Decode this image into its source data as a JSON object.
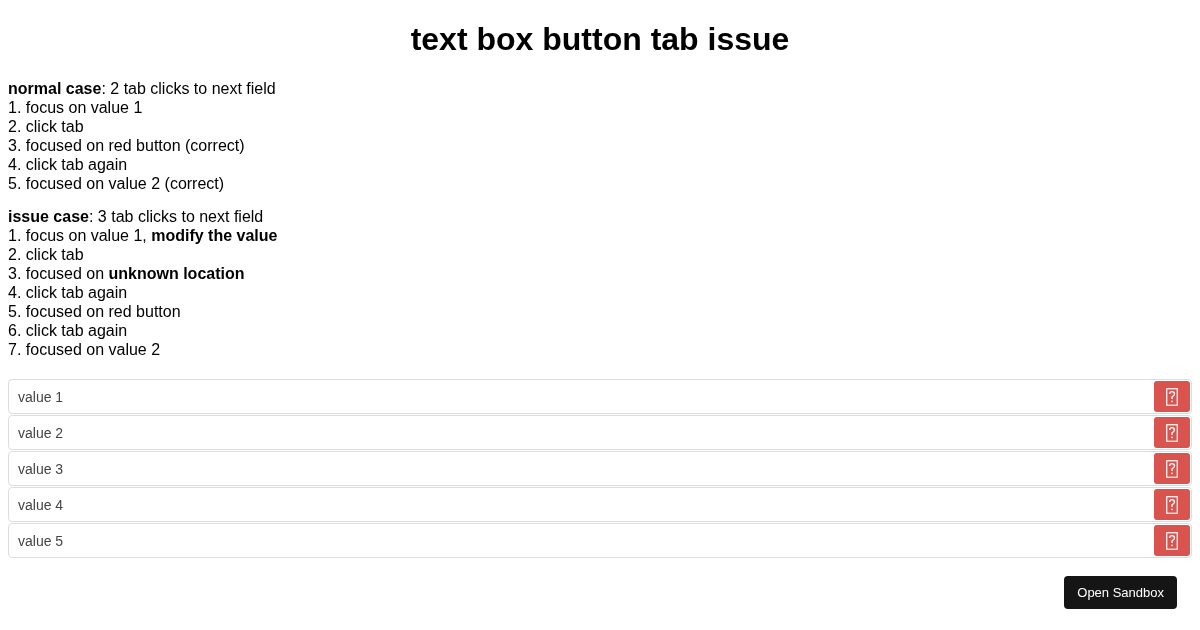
{
  "title": "text box button tab issue",
  "sections": [
    {
      "lines": [
        "**normal case**: 2 tab clicks to next field",
        "1. focus on value 1",
        "2. click tab",
        "3. focused on red button (correct)",
        "4. click tab again",
        "5. focused on value 2 (correct)"
      ]
    },
    {
      "lines": [
        "**issue case**: 3 tab clicks to next field",
        "1. focus on value 1, **modify the value**",
        "2. click tab",
        "3. focused on **unknown location**",
        "4. click tab again",
        "5. focused on red button",
        "6. click tab again",
        "7. focused on value 2"
      ]
    }
  ],
  "fields": [
    {
      "value": "value 1"
    },
    {
      "value": "value 2"
    },
    {
      "value": "value 3"
    },
    {
      "value": "value 4"
    },
    {
      "value": "value 5"
    }
  ],
  "sandbox_button": "Open Sandbox"
}
